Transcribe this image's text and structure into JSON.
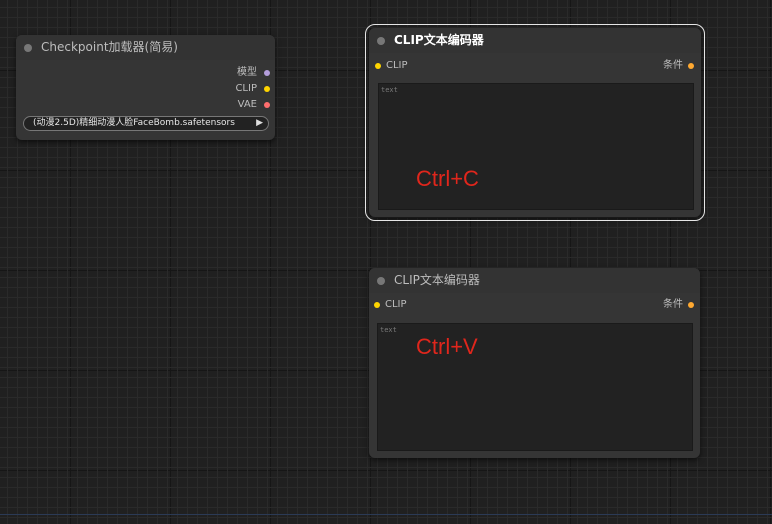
{
  "nodes": {
    "checkpoint_loader": {
      "title": "Checkpoint加载器(简易)",
      "outputs": [
        {
          "label": "模型",
          "color": "#b39ddb"
        },
        {
          "label": "CLIP",
          "color": "#ffd500"
        },
        {
          "label": "VAE",
          "color": "#ff6e6e"
        }
      ],
      "ckpt_value": "(动漫2.5D)精细动漫人脸FaceBomb.safetensors",
      "ckpt_arrow": "▶"
    },
    "clip_encoder_top": {
      "title": "CLIP文本编码器",
      "input": {
        "label": "CLIP",
        "color": "#ffd500"
      },
      "output": {
        "label": "条件",
        "color": "#ffa931"
      },
      "text_placeholder": "text"
    },
    "clip_encoder_bottom": {
      "title": "CLIP文本编码器",
      "input": {
        "label": "CLIP",
        "color": "#ffd500"
      },
      "output": {
        "label": "条件",
        "color": "#ffa931"
      },
      "text_placeholder": "text"
    }
  },
  "annotations": {
    "copy": "Ctrl+C",
    "paste": "Ctrl+V",
    "color": "#e0261c"
  }
}
